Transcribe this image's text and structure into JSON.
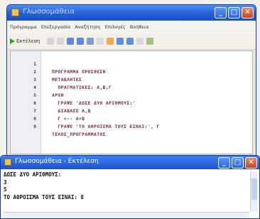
{
  "editor_window": {
    "title": "Γλωσσομάθεια",
    "buttons": {
      "minimize": "_",
      "maximize": "□",
      "close": "✕"
    },
    "menu": [
      "Πρόγραμμα",
      "Επεξεργασία",
      "Αναζήτηση",
      "Επιλογές",
      "Βοήθεια"
    ],
    "toolbar": {
      "run_label": "Εκτέλεση",
      "icons": [
        "cut-icon",
        "copy-icon",
        "paste-icon",
        "save-icon",
        "find-icon",
        "add-icon",
        "open-icon",
        "undo-icon",
        "redo-icon",
        "back-icon",
        "settings-icon"
      ]
    },
    "code": [
      {
        "n": "1",
        "text": "ΠΡΟΓΡΑΜΜΑ ΠΡΟΣΘΕΣΗ"
      },
      {
        "n": "2",
        "text": "ΜΕΤΑΒΛΗΤΕΣ"
      },
      {
        "n": "3",
        "text": "  ΠΡΑΓΜΑΤΙΚΕΣ: Α,Β,Γ"
      },
      {
        "n": "4",
        "text": "ΑΡΧΗ"
      },
      {
        "n": "5",
        "text": "  ΓΡΑΨΕ 'ΔΩΣΕ ΔΥΟ ΑΡΙΘΜΟΥΣ:'"
      },
      {
        "n": "6",
        "text": "  ΔΙΑΒΑΣΕ Α,Β"
      },
      {
        "n": "7",
        "text": "  Γ <-- Α+Β"
      },
      {
        "n": "8",
        "text": "  ΓΡΑΨΕ 'ΤΟ ΑΘΡΟΙΣΜΑ ΤΟΥΣ ΕΙΝΑΙ:', Γ"
      },
      {
        "n": "9",
        "text": "ΤΕΛΟΣ_ΠΡΟΓΡΑΜΜΑΤΟΣ"
      }
    ]
  },
  "output_window": {
    "title": "Γλωσσομάθεια - Εκτέλεση",
    "buttons": {
      "minimize": "_",
      "maximize": "□",
      "close": "✕"
    },
    "lines": [
      "ΔΩΣΕ ΔΥΟ ΑΡΙΘΜΟΥΣ:",
      "3",
      "5",
      "ΤΟ ΑΘΡΟΙΣΜΑ ΤΟΥΣ ΕΙΝΑΙ: 8"
    ]
  }
}
